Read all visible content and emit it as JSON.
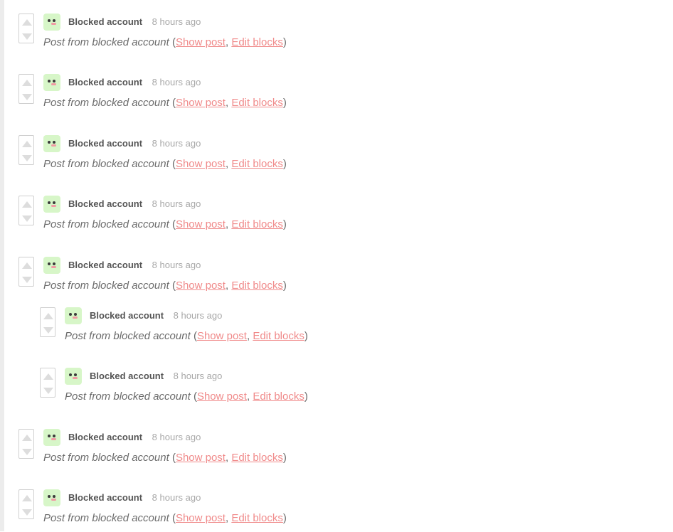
{
  "posts": [
    {
      "author": "Blocked account",
      "time": "8 hours ago",
      "text": "Post from blocked account",
      "show_post": "Show post",
      "edit_blocks": "Edit blocks"
    },
    {
      "author": "Blocked account",
      "time": "8 hours ago",
      "text": "Post from blocked account",
      "show_post": "Show post",
      "edit_blocks": "Edit blocks"
    },
    {
      "author": "Blocked account",
      "time": "8 hours ago",
      "text": "Post from blocked account",
      "show_post": "Show post",
      "edit_blocks": "Edit blocks"
    },
    {
      "author": "Blocked account",
      "time": "8 hours ago",
      "text": "Post from blocked account",
      "show_post": "Show post",
      "edit_blocks": "Edit blocks"
    },
    {
      "author": "Blocked account",
      "time": "8 hours ago",
      "text": "Post from blocked account",
      "show_post": "Show post",
      "edit_blocks": "Edit blocks"
    },
    {
      "author": "Blocked account",
      "time": "8 hours ago",
      "text": "Post from blocked account",
      "show_post": "Show post",
      "edit_blocks": "Edit blocks"
    },
    {
      "author": "Blocked account",
      "time": "8 hours ago",
      "text": "Post from blocked account",
      "show_post": "Show post",
      "edit_blocks": "Edit blocks"
    },
    {
      "author": "Blocked account",
      "time": "8 hours ago",
      "text": "Post from blocked account",
      "show_post": "Show post",
      "edit_blocks": "Edit blocks"
    },
    {
      "author": "Blocked account",
      "time": "8 hours ago",
      "text": "Post from blocked account",
      "show_post": "Show post",
      "edit_blocks": "Edit blocks"
    }
  ],
  "colors": {
    "link": "#f08a8a",
    "avatar_bg": "#d7f6c8",
    "muted": "#a8a8a8"
  },
  "icons": {
    "upvote": "upvote-arrow-icon",
    "downvote": "downvote-arrow-icon",
    "avatar": "frog-avatar-icon"
  }
}
